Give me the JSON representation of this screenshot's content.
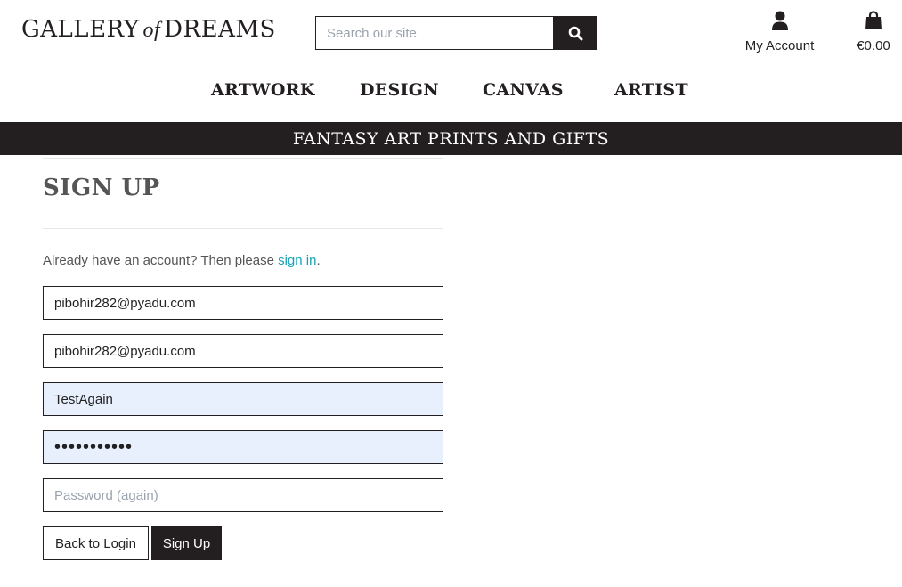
{
  "header": {
    "logo": {
      "word1": "GALLERY",
      "word2": "of",
      "word3": "DREAMS"
    },
    "search": {
      "placeholder": "Search our site",
      "icon": "search-icon"
    },
    "account": {
      "label": "My Account",
      "icon": "user-icon"
    },
    "cart": {
      "label": "€0.00",
      "icon": "shopping-bag-icon"
    }
  },
  "nav": {
    "items": [
      "ARTWORK",
      "DESIGN",
      "CANVAS",
      "ARTIST"
    ]
  },
  "banner": {
    "text": "FANTASY ART PRINTS AND GIFTS"
  },
  "form": {
    "title": "SIGN UP",
    "hint_prefix": "Already have an account? Then please ",
    "hint_link": "sign in",
    "hint_suffix": ".",
    "email": {
      "value": "pibohir282@pyadu.com"
    },
    "email_confirm": {
      "value": "pibohir282@pyadu.com"
    },
    "username": {
      "value": "TestAgain"
    },
    "password": {
      "value": "•••••••••••"
    },
    "password_again": {
      "placeholder": "Password (again)",
      "value": ""
    },
    "back_label": "Back to Login",
    "signup_label": "Sign Up"
  },
  "colors": {
    "dark": "#231f20",
    "link": "#17a2b8",
    "autofill": "#e8f0fe"
  }
}
